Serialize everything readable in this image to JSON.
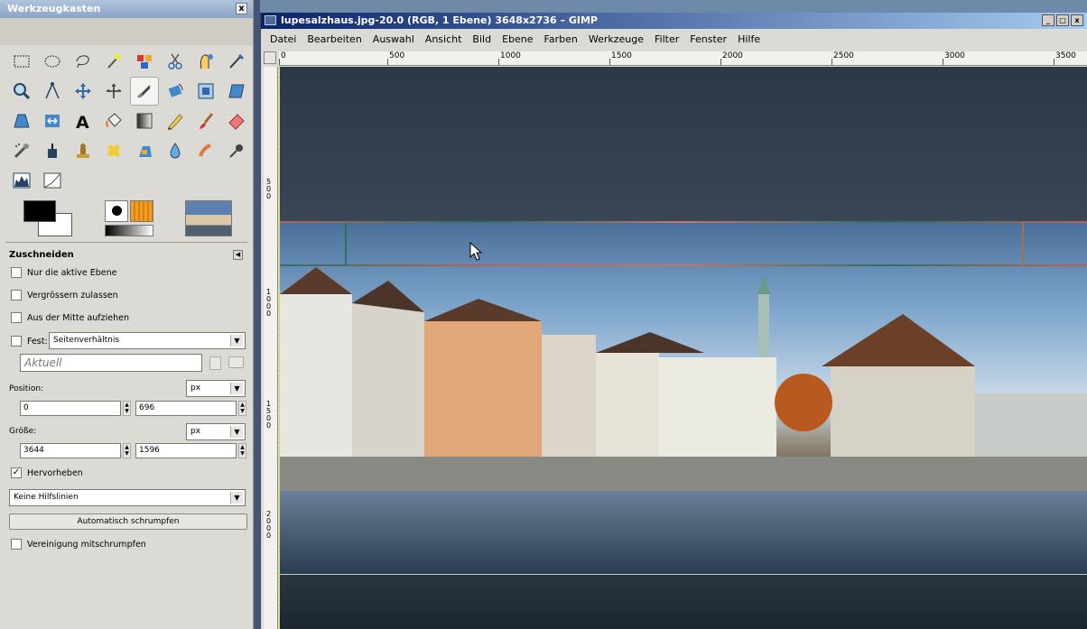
{
  "toolbox": {
    "title": "Werkzeugkasten",
    "close": "x",
    "tools": [
      "rect-select",
      "ellipse-select",
      "free-select",
      "fuzzy-select",
      "color-select",
      "scissors-select",
      "foreground-select",
      "paths",
      "color-picker",
      "zoom",
      "measure",
      "move",
      "align",
      "crop",
      "rotate",
      "scale",
      "shear",
      "perspective",
      "flip",
      "text",
      "bucket-fill",
      "blend",
      "pencil",
      "paintbrush",
      "eraser",
      "airbrush",
      "ink",
      "clone",
      "heal",
      "perspective-clone",
      "blur",
      "smudge",
      "dodge-burn",
      "levels",
      "curves"
    ],
    "active_tool": "crop",
    "options": {
      "title": "Zuschneiden",
      "current_layer_only": {
        "label": "Nur die aktive Ebene",
        "checked": false
      },
      "allow_growing": {
        "label": "Vergrössern zulassen",
        "checked": false
      },
      "expand_from_center": {
        "label": "Aus der Mitte aufziehen",
        "checked": false
      },
      "fixed": {
        "label": "Fest:",
        "checked": false,
        "mode": "Seitenverhältnis"
      },
      "aspect_value": "Aktuell",
      "position_label": "Position:",
      "position_unit": "px",
      "position_x": "0",
      "position_y": "696",
      "size_label": "Größe:",
      "size_unit": "px",
      "size_w": "3644",
      "size_h": "1596",
      "highlight": {
        "label": "Hervorheben",
        "checked": true
      },
      "guides": "Keine Hilfslinien",
      "auto_shrink": "Automatisch schrumpfen",
      "shrink_merged": {
        "label": "Vereinigung mitschrumpfen",
        "checked": false
      }
    }
  },
  "image_window": {
    "title": "lupesalzhaus.jpg-20.0 (RGB, 1 Ebene) 3648x2736 – GIMP",
    "window_buttons": [
      "_",
      "□",
      "x"
    ],
    "menu": [
      "Datei",
      "Bearbeiten",
      "Auswahl",
      "Ansicht",
      "Bild",
      "Ebene",
      "Farben",
      "Werkzeuge",
      "Filter",
      "Fenster",
      "Hilfe"
    ],
    "ruler_top": [
      "0",
      "500",
      "1000",
      "1500",
      "2000",
      "2500",
      "3000",
      "3500"
    ],
    "ruler_left": [
      "500",
      "1000",
      "1500",
      "2000"
    ]
  },
  "colors": {
    "sky_dark": "#2d3846",
    "sky_light": "#7ea6cc",
    "crop_green": "#2e7060",
    "crop_red": "#c06050",
    "titlebar": "#0a246a"
  }
}
